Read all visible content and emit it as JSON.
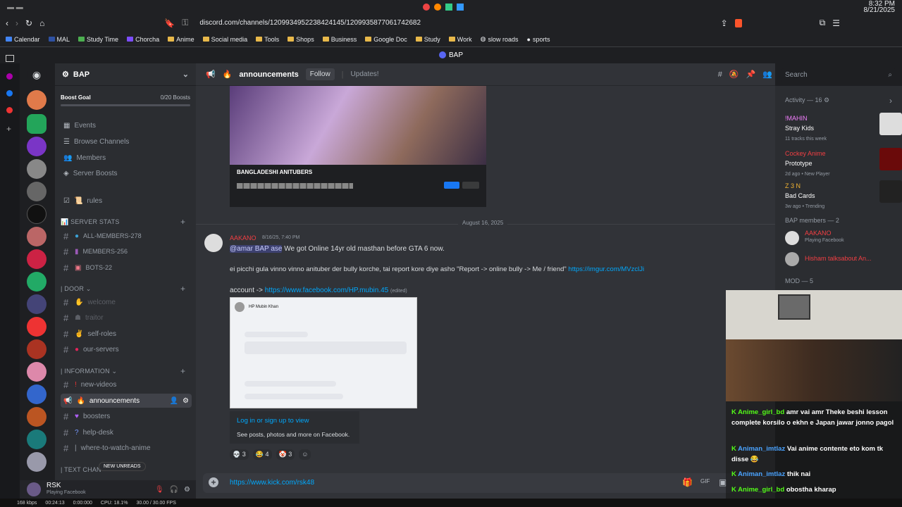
{
  "os": {
    "time": "8:32 PM",
    "date": "8/21/2025"
  },
  "browser": {
    "url": "discord.com/channels/1209934952238424145/1209935877061742682",
    "tab_title": "BAP"
  },
  "bookmarks": [
    {
      "label": "Calendar"
    },
    {
      "label": "MAL"
    },
    {
      "label": "Study Time"
    },
    {
      "label": "Chorcha"
    },
    {
      "label": "Anime"
    },
    {
      "label": "Social media"
    },
    {
      "label": "Tools"
    },
    {
      "label": "Shops"
    },
    {
      "label": "Business"
    },
    {
      "label": "Google Doc"
    },
    {
      "label": "Study"
    },
    {
      "label": "Work"
    },
    {
      "label": "slow roads"
    },
    {
      "label": "sports"
    }
  ],
  "server": {
    "name": "BAP",
    "boost_goal": "Boost Goal",
    "boost_count": "0/20 Boosts",
    "nav": [
      {
        "label": "Events"
      },
      {
        "label": "Browse Channels"
      },
      {
        "label": "Members"
      },
      {
        "label": "Server Boosts"
      }
    ],
    "channels": {
      "rules": "rules",
      "cat_stats": "SERVER STATS",
      "all_members": "ALL-MEMBERS-278",
      "members": "MEMBERS-256",
      "bots": "BOTS-22",
      "cat_door": "DOOR",
      "welcome": "welcome",
      "traitor": "traitor",
      "self_roles": "self-roles",
      "our_servers": "our-servers",
      "cat_info": "INFORMATION",
      "new_videos": "new-videos",
      "announcements": "announcements",
      "boosters": "boosters",
      "help_desk": "help-desk",
      "where": "where-to-watch-anime",
      "cat_text": "TEXT CHAN",
      "new_unreads": "NEW UNREADS"
    },
    "user": {
      "name": "RSK",
      "status": "Playing Facebook"
    }
  },
  "header": {
    "channel": "announcements",
    "follow": "Follow",
    "topic": "Updates!",
    "search_placeholder": "Search"
  },
  "chat": {
    "embed_group": "BANGLADESHI ANITUBERS",
    "date_divider": "August 16, 2025",
    "msg": {
      "author": "AAKANO",
      "time": "8/16/25, 7:40 PM",
      "line1_mention": "@amar BAP ase",
      "line1": " We got Online 14yr old masthan before GTA 6 now.",
      "line2": "ei picchi gula vinno vinno anituber der bully korche, tai report kore diye asho \"Report -> online bully -> Me / friend\" ",
      "line2_link": "https://imgur.com/MVzclJi",
      "line3": "account -> ",
      "line3_link": "https://www.facebook.com/HP.mubin.45",
      "edited": "(edited)",
      "fb_name": "HP Mubin Khan",
      "fb_login": "Log in or sign up to view",
      "fb_sub": "See posts, photos and more on Facebook.",
      "reactions": [
        {
          "emoji": "💀",
          "count": "3"
        },
        {
          "emoji": "😂",
          "count": "4"
        },
        {
          "emoji": "🤡",
          "count": "3"
        }
      ]
    },
    "input_link": "https://www.kick.com/rsk48"
  },
  "members": {
    "activity": "Activity — 16",
    "acts": [
      {
        "user": "!MAHIN",
        "title": "Stray Kids",
        "sub": "11 tracks this week"
      },
      {
        "user": "Cockey Anime",
        "title": "Prototype",
        "sub": "2d ago • New Player"
      },
      {
        "user": "Z 3 N",
        "title": "Bad Cards",
        "sub": "3w ago • Trending"
      }
    ],
    "bap_hdr": "BAP members — 2",
    "bap": [
      {
        "name": "AAKANO",
        "status": "Playing Facebook"
      },
      {
        "name": "Hisham talksabout An..."
      }
    ],
    "mod": "MOD — 5"
  },
  "stream_chat": [
    {
      "user": "Anime_girl_bd",
      "text": "amr vai amr Theke beshi lesson complete korsilo o ekhn e Japan jawar jonno pagol"
    },
    {
      "user": "Animan_imtlaz",
      "text": "Vai anime contente eto kom tk disse 😂"
    },
    {
      "user": "Animan_imtlaz",
      "text": "thik nai"
    },
    {
      "user": "Anime_girl_bd",
      "text": "obostha kharap"
    }
  ],
  "status": {
    "kbps": "168 kbps",
    "time": "00:24:13",
    "t2": "0:00:000",
    "cpu": "CPU: 18.1%",
    "fps": "30.00 / 30.00 FPS"
  },
  "colors": {
    "accent": "#5865f2",
    "link": "#00a8fc",
    "red_name": "#f23f43"
  }
}
